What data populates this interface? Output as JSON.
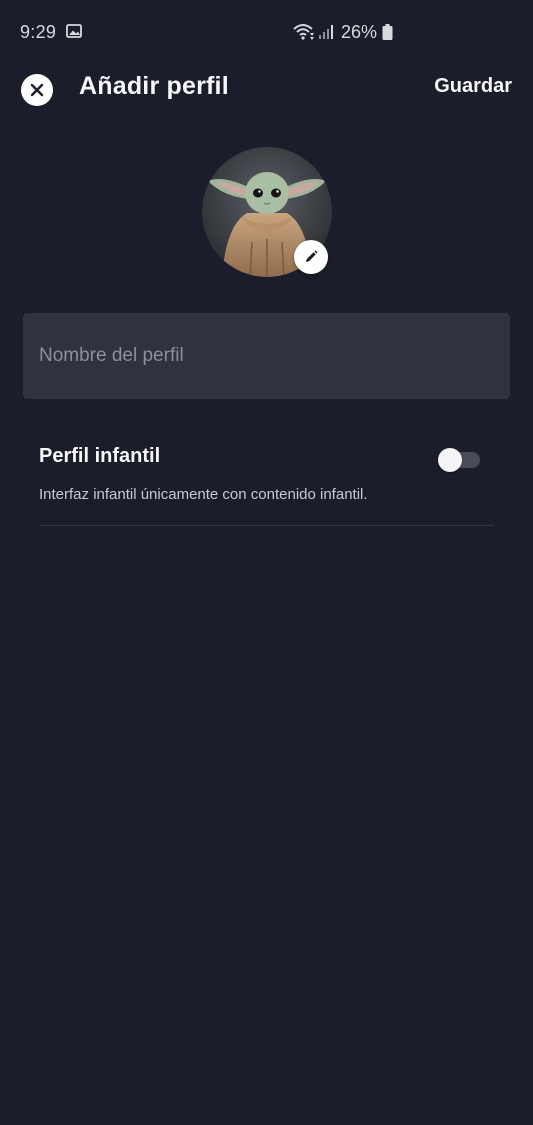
{
  "status_bar": {
    "time": "9:29",
    "battery_percent": "26%",
    "icons": [
      "gallery-icon",
      "wifi-icon",
      "signal-icon",
      "battery-icon"
    ]
  },
  "header": {
    "title": "Añadir perfil",
    "save_label": "Guardar",
    "close_icon": "close-icon"
  },
  "avatar": {
    "edit_icon": "pencil-icon"
  },
  "profile_name": {
    "placeholder": "Nombre del perfil",
    "value": ""
  },
  "kids_profile": {
    "title": "Perfil infantil",
    "description": "Interfaz infantil únicamente con contenido infantil.",
    "enabled": false
  },
  "colors": {
    "background": "#1b1d2a",
    "input_background": "#30323f",
    "text_primary": "#f7f7f9",
    "placeholder": "#8d8f9b"
  }
}
